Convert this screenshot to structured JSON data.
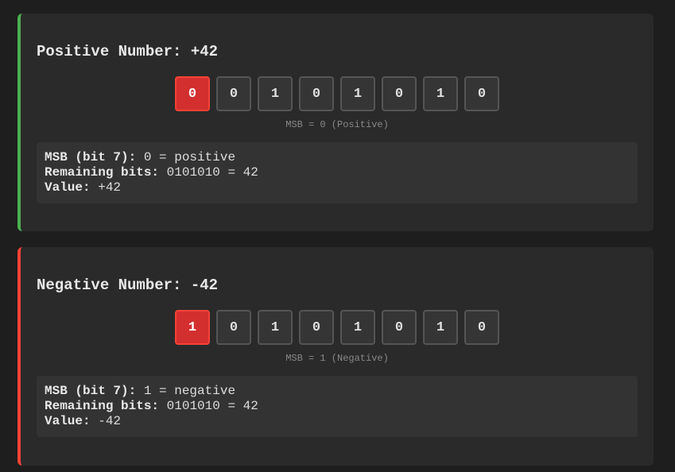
{
  "cards": [
    {
      "title": "Positive Number: +42",
      "bits": [
        "0",
        "0",
        "1",
        "0",
        "1",
        "0",
        "1",
        "0"
      ],
      "caption": "MSB = 0 (Positive)",
      "info": [
        {
          "label": "MSB (bit 7):",
          "value": " 0 = positive"
        },
        {
          "label": "Remaining bits:",
          "value": " 0101010 = 42"
        },
        {
          "label": "Value:",
          "value": " +42"
        }
      ],
      "accent": "#4caf50"
    },
    {
      "title": "Negative Number: -42",
      "bits": [
        "1",
        "0",
        "1",
        "0",
        "1",
        "0",
        "1",
        "0"
      ],
      "caption": "MSB = 1 (Negative)",
      "info": [
        {
          "label": "MSB (bit 7):",
          "value": " 1 = negative"
        },
        {
          "label": "Remaining bits:",
          "value": " 0101010 = 42"
        },
        {
          "label": "Value:",
          "value": " -42"
        }
      ],
      "accent": "#f44336"
    }
  ]
}
